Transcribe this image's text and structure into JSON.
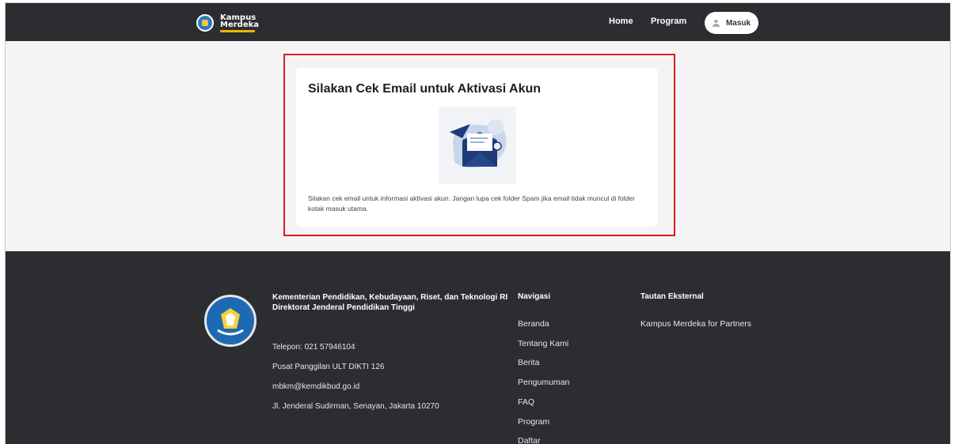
{
  "header": {
    "logo_line1": "Kampus",
    "logo_line2": "Merdeka",
    "nav_home": "Home",
    "nav_program": "Program",
    "login_label": "Masuk"
  },
  "card": {
    "title": "Silakan Cek Email untuk Aktivasi Akun",
    "description": "Silakan cek email untuk informasi aktivasi akun. Jangan lupa cek folder Spam jika email tidak muncul di folder kotak masuk utama."
  },
  "footer": {
    "org_name": "Kementerian Pendidikan, Kebudayaan, Riset, dan Teknologi RI",
    "org_sub": "Direktorat Jenderal Pendidikan Tinggi",
    "phone": "Telepon: 021 57946104",
    "call_center": "Pusat Panggilan ULT DIKTI 126",
    "email": "mbkm@kemdikbud.go.id",
    "address": "Jl. Jenderal Sudirman, Senayan, Jakarta 10270",
    "nav_title": "Navigasi",
    "nav_links": [
      "Beranda",
      "Tentang Kami",
      "Berita",
      "Pengumuman",
      "FAQ",
      "Program",
      "Daftar"
    ],
    "ext_title": "Tautan Eksternal",
    "ext_links": [
      "Kampus Merdeka for Partners"
    ]
  },
  "colors": {
    "header_bg": "#2b2d31",
    "highlight_border": "#e01b1b",
    "envelope": "#1e3a78"
  }
}
